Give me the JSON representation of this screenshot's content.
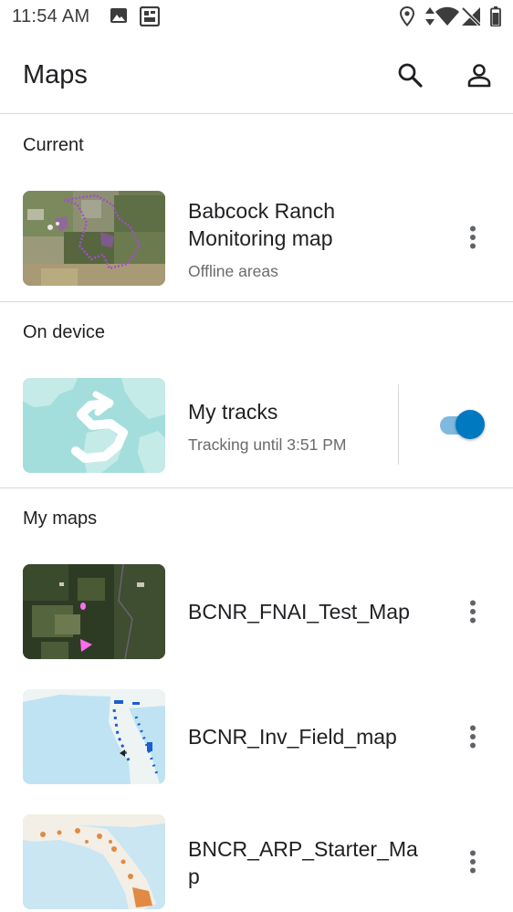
{
  "status_bar": {
    "time": "11:54 AM"
  },
  "app_bar": {
    "title": "Maps"
  },
  "colors": {
    "accent": "#0079c1",
    "accent_light": "#7fb9e0",
    "divider": "#d9d9d9",
    "secondary_text": "#6b6b6b"
  },
  "sections": {
    "current": {
      "header": "Current",
      "items": [
        {
          "title_line1": "Babcock Ranch",
          "title_line2": "Monitoring map",
          "subtitle": "Offline areas"
        }
      ]
    },
    "on_device": {
      "header": "On device",
      "items": [
        {
          "title": "My tracks",
          "subtitle": "Tracking until 3:51 PM",
          "tracking_enabled": true
        }
      ]
    },
    "my_maps": {
      "header": "My maps",
      "items": [
        {
          "title": "BCNR_FNAI_Test_Map"
        },
        {
          "title": "BCNR_Inv_Field_map"
        },
        {
          "title_line1": "BNCR_ARP_Starter_Ma",
          "title_line2": "p"
        }
      ]
    }
  },
  "icons": {
    "status": [
      "image-icon",
      "sd-card-icon",
      "location-pin-icon",
      "data-arrows-icon",
      "wifi-icon",
      "no-signal-icon",
      "battery-icon"
    ],
    "app_bar": [
      "search-icon",
      "account-icon"
    ],
    "row": "more-vert-icon"
  }
}
